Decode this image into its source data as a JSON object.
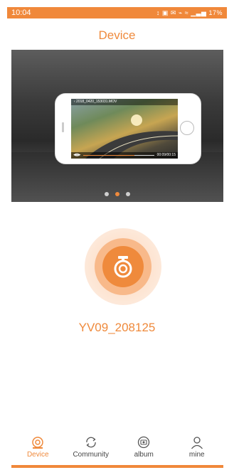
{
  "status_bar": {
    "time": "10:04",
    "indicators": "↕ ▣ ✉ ⌁ ≈ ▁▃▅ 17%",
    "battery": "17%"
  },
  "header": {
    "title": "Device"
  },
  "banner": {
    "video_title": "‹ 2018_0420_153031.MOV",
    "time_display": "00:09/00:15",
    "progress_fraction": 0.72,
    "carousel_dots": 3,
    "active_dot": 1
  },
  "device": {
    "name": "YV09_208125"
  },
  "tabs": [
    {
      "label": "Device",
      "icon": "dashcam-icon",
      "active": true
    },
    {
      "label": "Community",
      "icon": "refresh-icon",
      "active": false
    },
    {
      "label": "album",
      "icon": "album-icon",
      "active": false
    },
    {
      "label": "mine",
      "icon": "person-icon",
      "active": false
    }
  ],
  "colors": {
    "accent": "#ef8a3c",
    "status_bar": "#f0883a",
    "tab_text": "#444444"
  }
}
